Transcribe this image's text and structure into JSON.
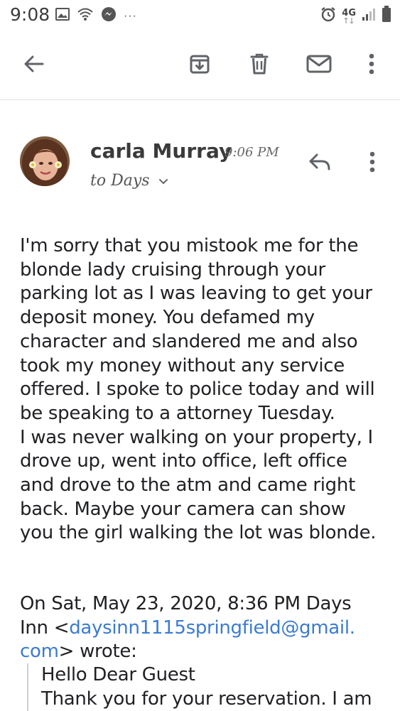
{
  "status_bar": {
    "time": "9:08",
    "dots": "···",
    "network": "4G",
    "icons": [
      "image-icon",
      "wifi-icon",
      "messenger-icon",
      "alarm-icon",
      "signal-icon",
      "battery-icon"
    ]
  },
  "toolbar": {
    "icons": [
      "back-arrow-icon",
      "archive-icon",
      "delete-icon",
      "mark-unread-icon",
      "more-vert-icon"
    ]
  },
  "message": {
    "sender": "carla Murray",
    "time": "9:06 PM",
    "recipient": "to Days",
    "body": [
      "I'm sorry that you mistook me for the",
      "blonde lady cruising through your",
      "parking lot as I was leaving to get your",
      "deposit money. You defamed my",
      "character and slandered me and also",
      "took my money without any service",
      "offered. I spoke to police today and will",
      "be speaking to a attorney Tuesday.",
      "I was never walking on your property, I",
      "drove up, went into office, left office",
      "and drove to the atm and came right",
      "back. Maybe your camera can show",
      "you the girl walking the lot was blonde."
    ]
  },
  "quote": {
    "header_line1": "On Sat, May 23, 2020, 8:36 PM Days",
    "header_prefix": "Inn <",
    "email_part1": "daysinn1115springfield@gmail.",
    "email_part2": "com",
    "header_suffix": "> wrote:",
    "lines": [
      "Hello Dear Guest",
      "Thank you for your reservation. I am"
    ]
  },
  "colors": {
    "link": "#3b7bd4",
    "text": "#202124",
    "icon": "#5f6368",
    "divider": "#e0e0e0"
  }
}
